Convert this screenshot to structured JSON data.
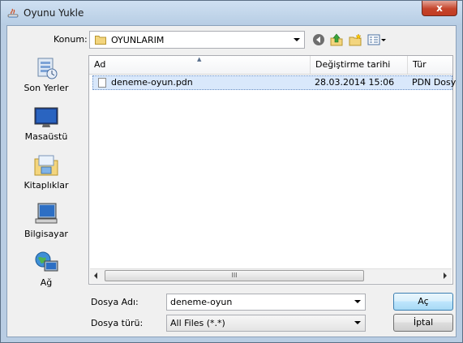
{
  "window": {
    "title": "Oyunu Yukle",
    "close_glyph": "x"
  },
  "toolbar": {
    "look_in_label": "Konum:",
    "look_in_value": "OYUNLARIM",
    "icons": [
      "back-icon",
      "up-folder-icon",
      "new-folder-icon",
      "view-menu-icon"
    ]
  },
  "places": [
    {
      "label": "Son Yerler",
      "icon": "recent-places-icon"
    },
    {
      "label": "Masaüstü",
      "icon": "desktop-icon"
    },
    {
      "label": "Kitaplıklar",
      "icon": "libraries-icon"
    },
    {
      "label": "Bilgisayar",
      "icon": "computer-icon"
    },
    {
      "label": "Ağ",
      "icon": "network-icon"
    }
  ],
  "filelist": {
    "columns": [
      "Ad",
      "Değiştirme tarihi",
      "Tür"
    ],
    "rows": [
      {
        "name": "deneme-oyun.pdn",
        "modified": "28.03.2014 15:06",
        "type": "PDN Dosy"
      }
    ],
    "scroll_grip": "III"
  },
  "footer": {
    "filename_label": "Dosya Adı:",
    "filename_value": "deneme-oyun",
    "filetype_label": "Dosya türü:",
    "filetype_value": "All Files (*.*)",
    "open_label": "Aç",
    "cancel_label": "İptal"
  },
  "colors": {
    "frame": "#b9cde3",
    "selection": "#d9e8fb",
    "close": "#c5442b"
  }
}
